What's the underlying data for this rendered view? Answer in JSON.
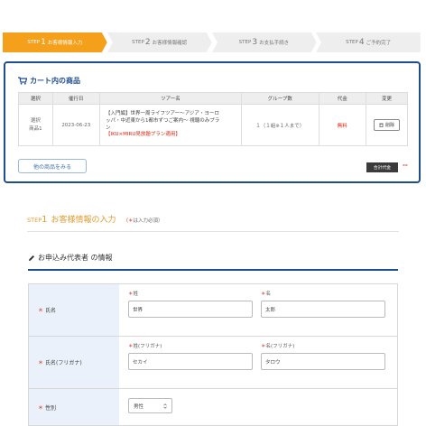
{
  "steps": [
    {
      "prefix": "STEP",
      "num": "1",
      "label": "お客様情報入力"
    },
    {
      "prefix": "STEP",
      "num": "2",
      "label": "お客様情報確認"
    },
    {
      "prefix": "STEP",
      "num": "3",
      "label": "お支払手続き"
    },
    {
      "prefix": "STEP",
      "num": "4",
      "label": "ご予約完了"
    }
  ],
  "colors": {
    "accent": "#f5a01a",
    "step_inactive": "#eeeeee",
    "navy": "#1f4d8a",
    "price_red": "#d9230f"
  },
  "cart": {
    "title": "カート内の商品",
    "icon": "cart-icon",
    "headers": [
      "選択",
      "催行日",
      "ツアー名",
      "グループ数",
      "代金",
      "変更"
    ],
    "row": {
      "select": "選択\n商品1",
      "date": "2023-06-23",
      "tour_line1": "【入門編】世界一周ライフツアー〜アジア・ヨーロ",
      "tour_line2": "ッパ・中近東から1都市ずつご案内〜 視聴のみプラ",
      "tour_line3": "ン",
      "tour_note": "【IKU×MIRU見放題プラン適用】",
      "groups": "１（１組※１人まで）",
      "price": "無料",
      "delete_label": "削除"
    },
    "more_button": "他の商品をみる",
    "total_label": "合計代金",
    "total_value": "--"
  },
  "section": {
    "step_prefix": "STEP",
    "step_num": "1",
    "title": "お客様情報の入力",
    "required_note": "（＊",
    "required_text": "は入力必須）"
  },
  "applicant": {
    "heading": "お申込み代表者 の情報",
    "rows": {
      "name": {
        "label": "氏名",
        "last_caption": "姓",
        "last_value": "世界",
        "first_caption": "名",
        "first_value": "太郎"
      },
      "kana": {
        "label": "氏名(フリガナ)",
        "last_caption": "姓(フリガナ)",
        "last_value": "セカイ",
        "first_caption": "名(フリガナ)",
        "first_value": "タロウ"
      },
      "gender": {
        "label": "性別",
        "value": "男性"
      }
    }
  }
}
